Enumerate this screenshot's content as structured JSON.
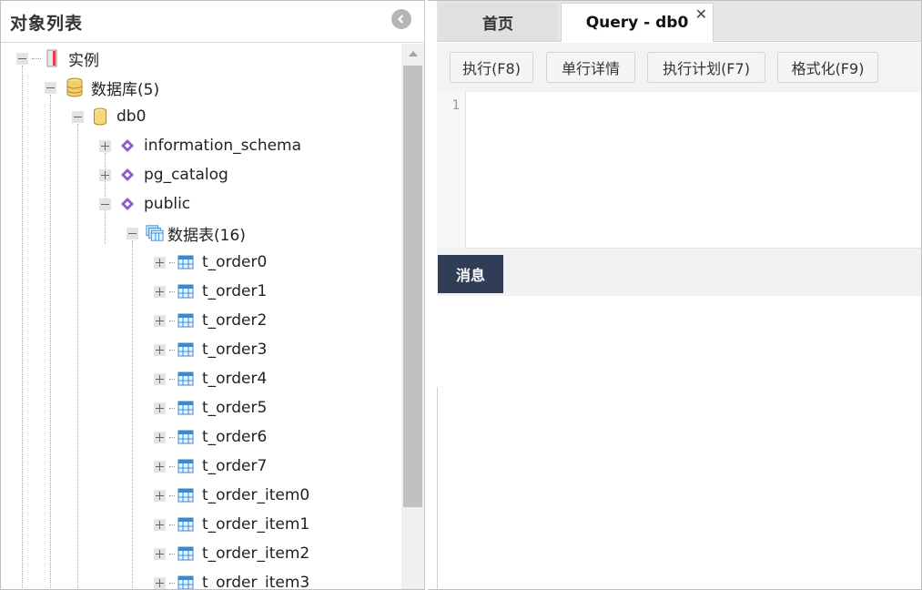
{
  "left_panel": {
    "title": "对象列表"
  },
  "tree": {
    "instance": "实例",
    "databases": "数据库(5)",
    "db": "db0",
    "schemas": [
      "information_schema",
      "pg_catalog",
      "public"
    ],
    "tables_group": "数据表(16)",
    "tables": [
      "t_order0",
      "t_order1",
      "t_order2",
      "t_order3",
      "t_order4",
      "t_order5",
      "t_order6",
      "t_order7",
      "t_order_item0",
      "t_order_item1",
      "t_order_item2",
      "t_order_item3"
    ]
  },
  "tabs": {
    "home": "首页",
    "query": "Query - db0",
    "close": "✕"
  },
  "toolbar": {
    "execute": "执行(F8)",
    "row_detail": "单行详情",
    "explain": "执行计划(F7)",
    "format": "格式化(F9)"
  },
  "editor": {
    "line_number": "1"
  },
  "messages": {
    "tab_label": "消息"
  },
  "colors": {
    "message_tab_bg": "#2f3e56",
    "schema_icon": "#8a5cc9",
    "table_icon": "#3a8ad6",
    "db_icon": "#e8c060"
  }
}
